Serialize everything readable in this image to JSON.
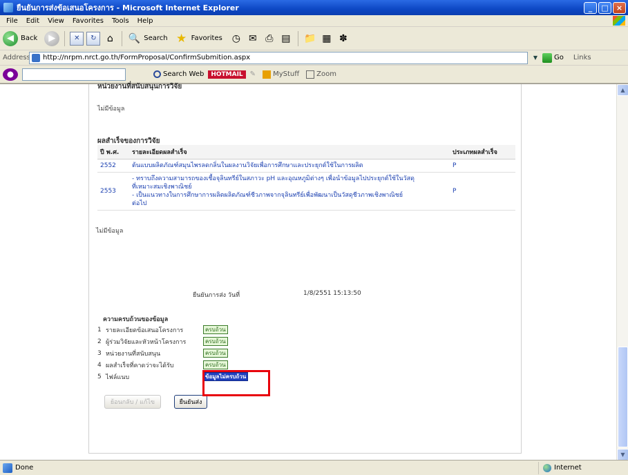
{
  "window": {
    "title": "ยืนยันการส่งข้อเสนอโครงการ - Microsoft Internet Explorer",
    "controls": [
      "_",
      "□",
      "×"
    ]
  },
  "menu": [
    "File",
    "Edit",
    "View",
    "Favorites",
    "Tools",
    "Help"
  ],
  "toolbar": {
    "back_label": "Back",
    "search_label": "Search",
    "favorites_label": "Favorites"
  },
  "address": {
    "label": "Address",
    "url": "http://nrpm.nrct.go.th/FormProposal/ConfirmSubmition.aspx",
    "go_label": "Go",
    "links_label": "Links"
  },
  "searchbar": {
    "search_web_label": "Search Web",
    "brand_label": "HOTMAIL",
    "mystuff_label": "MyStuff",
    "zoom_label": "Zoom"
  },
  "content": {
    "cut_heading": "หน่วยงานที่สนับสนุนการวิจัย",
    "section_text": "ไม่มีข้อมูล",
    "results_title": "ผลสำเร็จของการวิจัย",
    "table": {
      "headers": [
        "ปี พ.ศ.",
        "รายละเอียดผลสำเร็จ",
        "ประเภทผลสำเร็จ"
      ],
      "rows": [
        {
          "year": "2552",
          "detail": [
            "ต้นแบบผลิตภัณฑ์สมุนไพรลดกลิ่นในผลงานวิจัยเพื่อการศึกษาและประยุกต์ใช้ในการผลิต"
          ],
          "kind": "P"
        },
        {
          "year": "2553",
          "detail": [
            "- ทราบถึงความสามารถของเชื้อจุลินทรีย์ในสภาวะ pH และอุณหภูมิต่างๆ เพื่อนำข้อมูลไปประยุกต์ใช้ในวัสดุ",
            "ที่เหมาะสมเชิงพาณิชย์",
            "- เป็นแนวทางในการศึกษาการผลิตผลิตภัณฑ์ชีวภาพจากจุลินทรีย์เพื่อพัฒนาเป็นวัสดุชีวภาพเชิงพาณิชย์",
            "ต่อไป"
          ],
          "kind": "P"
        }
      ]
    },
    "remark": "ไม่มีข้อมูล",
    "submit_label": "ยืนยันการส่ง วันที่",
    "submit_time": "1/8/2551 15:13:50",
    "completeness_title": "ความครบถ้วนของข้อมูล",
    "checklist": [
      {
        "num": "1",
        "label": "รายละเอียดข้อเสนอโครงการ",
        "status": "ครบถ้วน",
        "complete": true
      },
      {
        "num": "2",
        "label": "ผู้ร่วมวิจัยและหัวหน้าโครงการ",
        "status": "ครบถ้วน",
        "complete": true
      },
      {
        "num": "3",
        "label": "หน่วยงานที่สนับสนุน",
        "status": "ครบถ้วน",
        "complete": true
      },
      {
        "num": "4",
        "label": "ผลสำเร็จที่คาดว่าจะได้รับ",
        "status": "ครบถ้วน",
        "complete": true
      },
      {
        "num": "5",
        "label": "ไฟล์แนบ",
        "status": "ข้อมูลไม่ครบถ้วน",
        "complete": false
      }
    ],
    "back_button": "ย้อนกลับ / แก้ไข",
    "submit_button": "ยืนยันส่ง"
  },
  "status": {
    "text": "Done",
    "zone": "Internet"
  },
  "colors": {
    "title_bar": "#0b3fb0",
    "link": "#1a3fb0",
    "highlight": "#e8000b",
    "incomplete_badge": "#1f3fbf"
  }
}
